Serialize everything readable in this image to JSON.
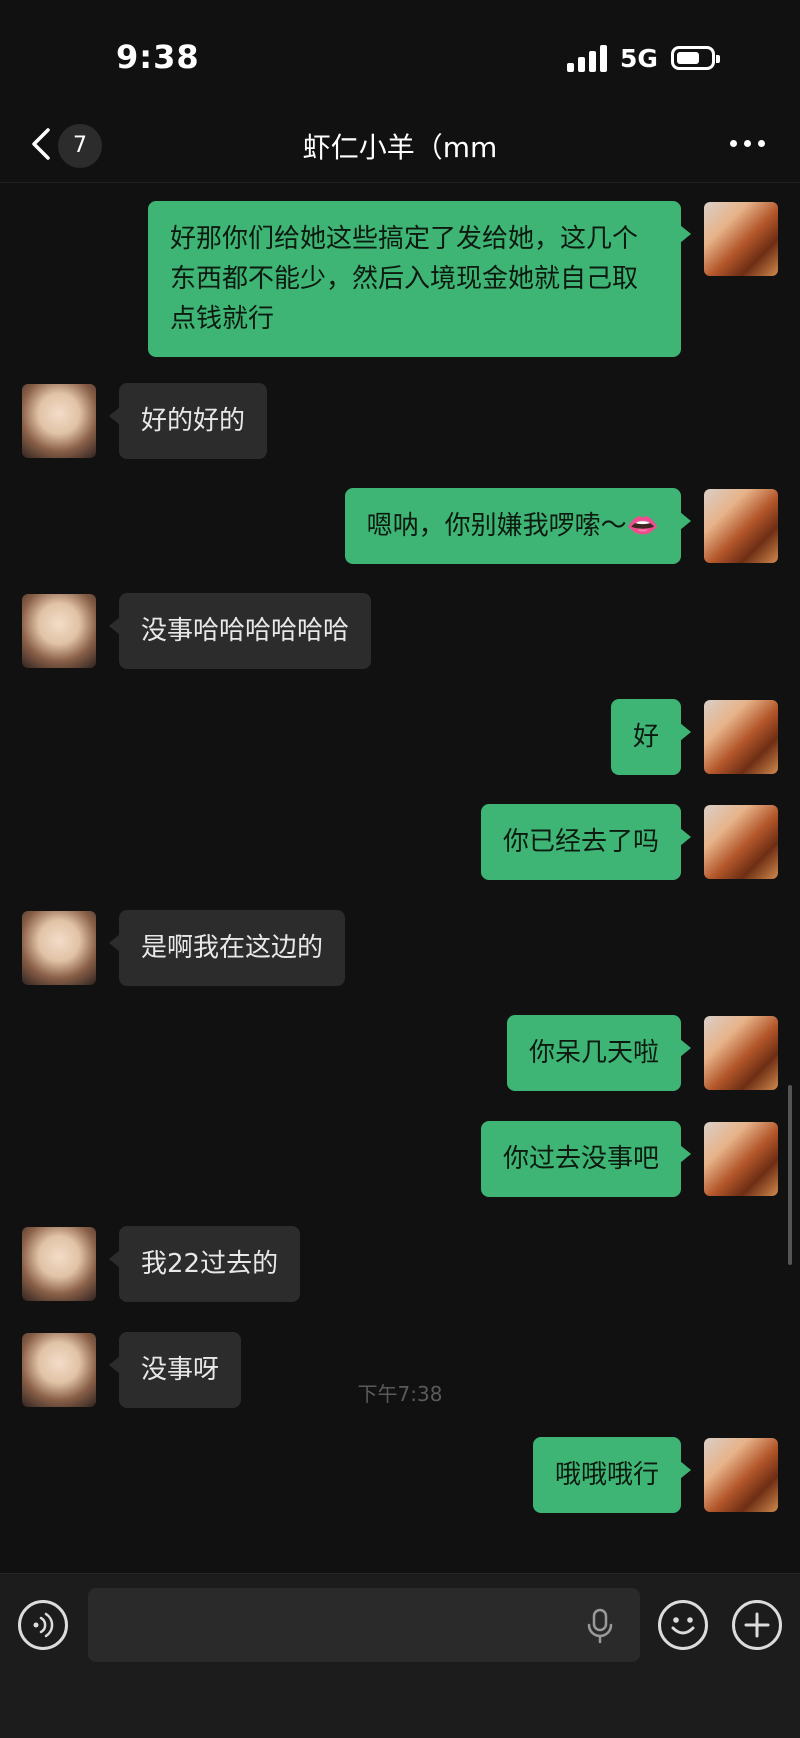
{
  "status_bar": {
    "time": "9:38",
    "network": "5G",
    "signal_icon": "signal-bars-icon",
    "battery_icon": "battery-icon"
  },
  "nav": {
    "back_icon": "chevron-left-icon",
    "unread_count": "7",
    "title": "虾仁小羊（mm",
    "more_icon": "more-dots-icon"
  },
  "messages": [
    {
      "sender": "me",
      "text": "好那你们给她这些搞定了发给她，这几个东西都不能少，然后入境现金她就自己取点钱就行"
    },
    {
      "sender": "them",
      "text": "好的好的"
    },
    {
      "sender": "me",
      "text": "嗯呐，你别嫌我啰嗦～👄"
    },
    {
      "sender": "them",
      "text": "没事哈哈哈哈哈哈"
    },
    {
      "sender": "me",
      "text": "好"
    },
    {
      "sender": "me",
      "text": "你已经去了吗"
    },
    {
      "sender": "them",
      "text": "是啊我在这边的"
    },
    {
      "sender": "me",
      "text": "你呆几天啦"
    },
    {
      "sender": "me",
      "text": "你过去没事吧"
    },
    {
      "sender": "them",
      "text": "我22过去的"
    },
    {
      "sender": "them",
      "text": "没事呀"
    },
    {
      "sender": "me",
      "text": "哦哦哦行"
    }
  ],
  "timestamp": "下午7:38",
  "input_bar": {
    "voice_icon": "voice-icon",
    "input_value": "",
    "mic_icon": "microphone-icon",
    "emoji_icon": "emoji-smile-icon",
    "plus_icon": "plus-circle-icon"
  },
  "colors": {
    "background": "#111111",
    "my_bubble": "#3eb575",
    "their_bubble": "#2c2c2c",
    "input_bar": "#1c1c1c"
  }
}
